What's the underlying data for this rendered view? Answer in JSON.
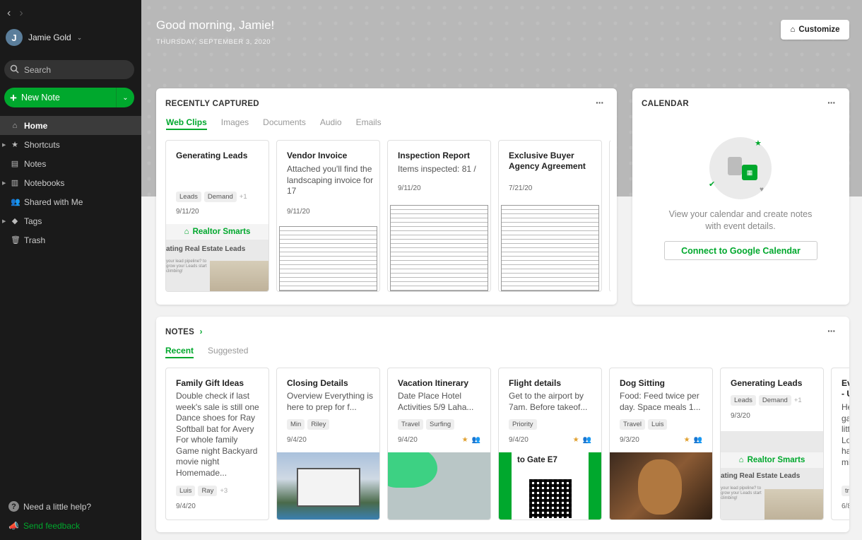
{
  "sidebar": {
    "account_name": "Jamie Gold",
    "avatar_initial": "J",
    "search_label": "Search",
    "new_note_label": "New Note",
    "nav": [
      {
        "label": "Home",
        "icon": "home-icon"
      },
      {
        "label": "Shortcuts",
        "icon": "star-icon"
      },
      {
        "label": "Notes",
        "icon": "note-icon"
      },
      {
        "label": "Notebooks",
        "icon": "notebook-icon"
      },
      {
        "label": "Shared with Me",
        "icon": "people-icon"
      },
      {
        "label": "Tags",
        "icon": "tag-icon"
      },
      {
        "label": "Trash",
        "icon": "trash-icon"
      }
    ],
    "help_label": "Need a little help?",
    "feedback_label": "Send feedback"
  },
  "header": {
    "greeting": "Good morning, Jamie!",
    "date": "THURSDAY, SEPTEMBER 3, 2020",
    "customize_label": "Customize"
  },
  "recently_captured": {
    "title": "RECENTLY CAPTURED",
    "tabs": [
      "Web Clips",
      "Images",
      "Documents",
      "Audio",
      "Emails"
    ],
    "items": [
      {
        "title": "Generating Leads",
        "tags": [
          "Leads",
          "Demand"
        ],
        "tag_more": "+1",
        "date": "9/11/20",
        "thumb_brand": "Realtor Smarts",
        "thumb_heading": "ating Real Estate Leads",
        "thumb_small": "your lead pipeline? to grow your Leads start climbing!"
      },
      {
        "title": "Vendor Invoice",
        "body": "Attached you'll find the landscaping invoice for 17",
        "date": "9/11/20"
      },
      {
        "title": "Inspection Report",
        "body": "Items inspected: 81 /",
        "date": "9/11/20"
      },
      {
        "title": "Exclusive Buyer Agency Agreement",
        "date": "7/21/20"
      }
    ]
  },
  "calendar": {
    "title": "CALENDAR",
    "text": "View your calendar and create notes with event details.",
    "button": "Connect to Google Calendar"
  },
  "notes": {
    "title": "NOTES",
    "tabs": [
      "Recent",
      "Suggested"
    ],
    "items": [
      {
        "title": "Family Gift Ideas",
        "body": "Double check if last week's sale is still one Dance shoes for Ray Softball bat for Avery For whole family Game night Backyard movie night Homemade...",
        "tags": [
          "Luis",
          "Ray"
        ],
        "tag_more": "+3",
        "date": "9/4/20"
      },
      {
        "title": "Closing Details",
        "body": "Overview Everything is here to prep for f...",
        "tags": [
          "Min",
          "Riley"
        ],
        "date": "9/4/20"
      },
      {
        "title": "Vacation Itinerary",
        "body": "Date Place Hotel Activities 5/9 Laha...",
        "tags": [
          "Travel",
          "Surfing"
        ],
        "date": "9/4/20"
      },
      {
        "title": "Flight details",
        "body": "Get to the airport by 7am. Before takeof...",
        "tags": [
          "Priority"
        ],
        "date": "9/4/20",
        "ticket": "to Gate E7"
      },
      {
        "title": "Dog Sitting",
        "body": "Food: Feed twice per day. Space meals 1...",
        "tags": [
          "Travel",
          "Luis"
        ],
        "date": "9/3/20"
      },
      {
        "title": "Generating Leads",
        "tags": [
          "Leads",
          "Demand"
        ],
        "tag_more": "+1",
        "date": "9/3/20",
        "thumb_brand": "Realtor Smarts",
        "thumb_heading": "ating Real Estate Leads",
        "thumb_small": "your lead pipeline? to grow your Leads start climbing!"
      },
      {
        "title": "Ev - U",
        "body": "He ga litt Lo ha mi",
        "tags": [
          "tr"
        ],
        "date": "6/8"
      }
    ]
  },
  "colors": {
    "accent": "#00a82d",
    "sidebar": "#1a1a1a"
  }
}
